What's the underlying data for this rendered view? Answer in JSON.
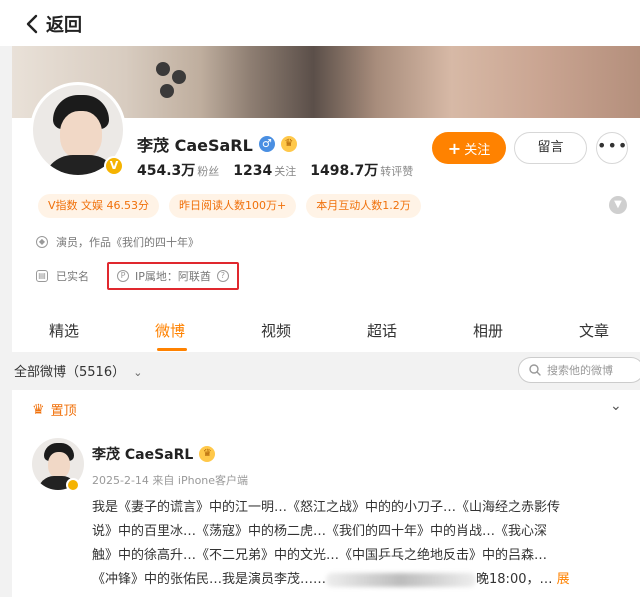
{
  "header": {
    "back_label": "返回"
  },
  "profile": {
    "name": "李茂 CaeSaRL",
    "verified_badge": "V",
    "gender_icon": "male-icon",
    "stats": [
      {
        "value": "454.3万",
        "label": "粉丝"
      },
      {
        "value": "1234",
        "label": "关注"
      },
      {
        "value": "1498.7万",
        "label": "转评赞"
      }
    ],
    "follow_label": "关注",
    "message_label": "留言",
    "more_label": "•••",
    "tags": [
      "V指数 文娱 46.53分",
      "昨日阅读人数100万+",
      "本月互动人数1.2万"
    ],
    "info_occupation": "演员，作品《我们的四十年》",
    "info_realname": "已实名",
    "info_ip": "IP属地：阿联酋",
    "highlight_color": "#e0282e"
  },
  "tabs": [
    {
      "label": "精选",
      "active": false
    },
    {
      "label": "微博",
      "active": true
    },
    {
      "label": "视频",
      "active": false
    },
    {
      "label": "超话",
      "active": false
    },
    {
      "label": "相册",
      "active": false
    },
    {
      "label": "文章",
      "active": false
    }
  ],
  "filter": {
    "label": "全部微博（5516）",
    "search_placeholder": "搜索他的微博"
  },
  "post": {
    "pinned_label": "置顶",
    "author": "李茂 CaeSaRL",
    "meta": "2025-2-14 来自 iPhone客户端",
    "line1": "我是《妻子的谎言》中的江一明…《怒江之战》中的的小刀子…《山海经之赤影传",
    "line2": "说》中的百里冰…《荡寇》中的杨二虎…《我们的四十年》中的肖战…《我心深",
    "line3": "触》中的徐高升…《不二兄弟》中的文光…《中国乒乓之绝地反击》中的吕森…",
    "line4_start": "《冲锋》中的张佑民…我是演员李茂……",
    "line4_end": "晚18:00，…",
    "more": "展"
  },
  "colors": {
    "accent": "#ff8200",
    "tag_bg": "#fff3e6",
    "tag_text": "#f0700a"
  }
}
